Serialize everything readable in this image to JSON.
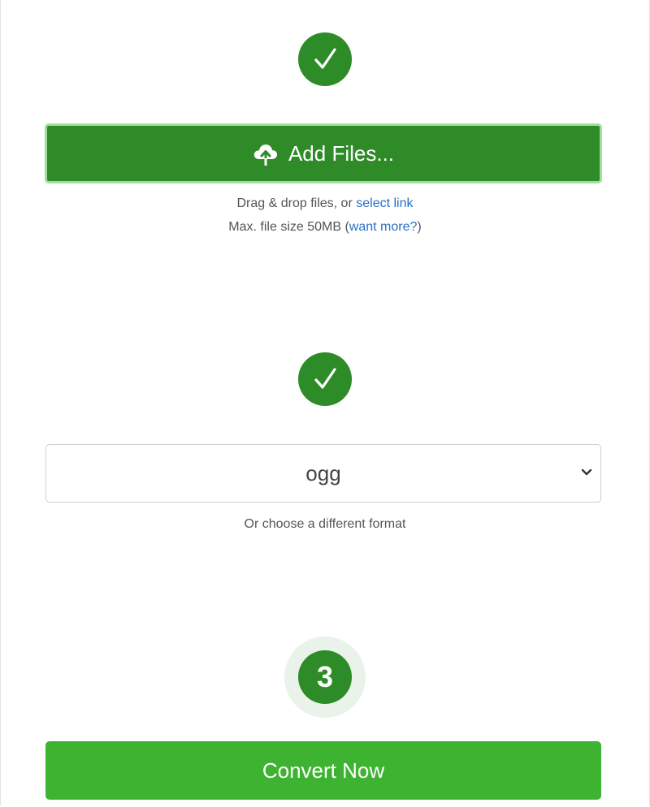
{
  "step1": {
    "icon": "check-icon"
  },
  "upload": {
    "button_label": "Add Files...",
    "icon": "cloud-upload-icon",
    "drag_text": "Drag & drop files, or ",
    "select_link": "select link",
    "max_text": "Max. file size 50MB (",
    "want_more_link": "want more?",
    "max_text_close": ")"
  },
  "step2": {
    "icon": "check-icon"
  },
  "format": {
    "selected": "ogg",
    "hint": "Or choose a different format"
  },
  "step3": {
    "number": "3"
  },
  "convert": {
    "button_label": "Convert Now"
  },
  "colors": {
    "primary_green": "#2e8b28",
    "convert_green": "#3eb332",
    "link_blue": "#2a6fc9"
  }
}
